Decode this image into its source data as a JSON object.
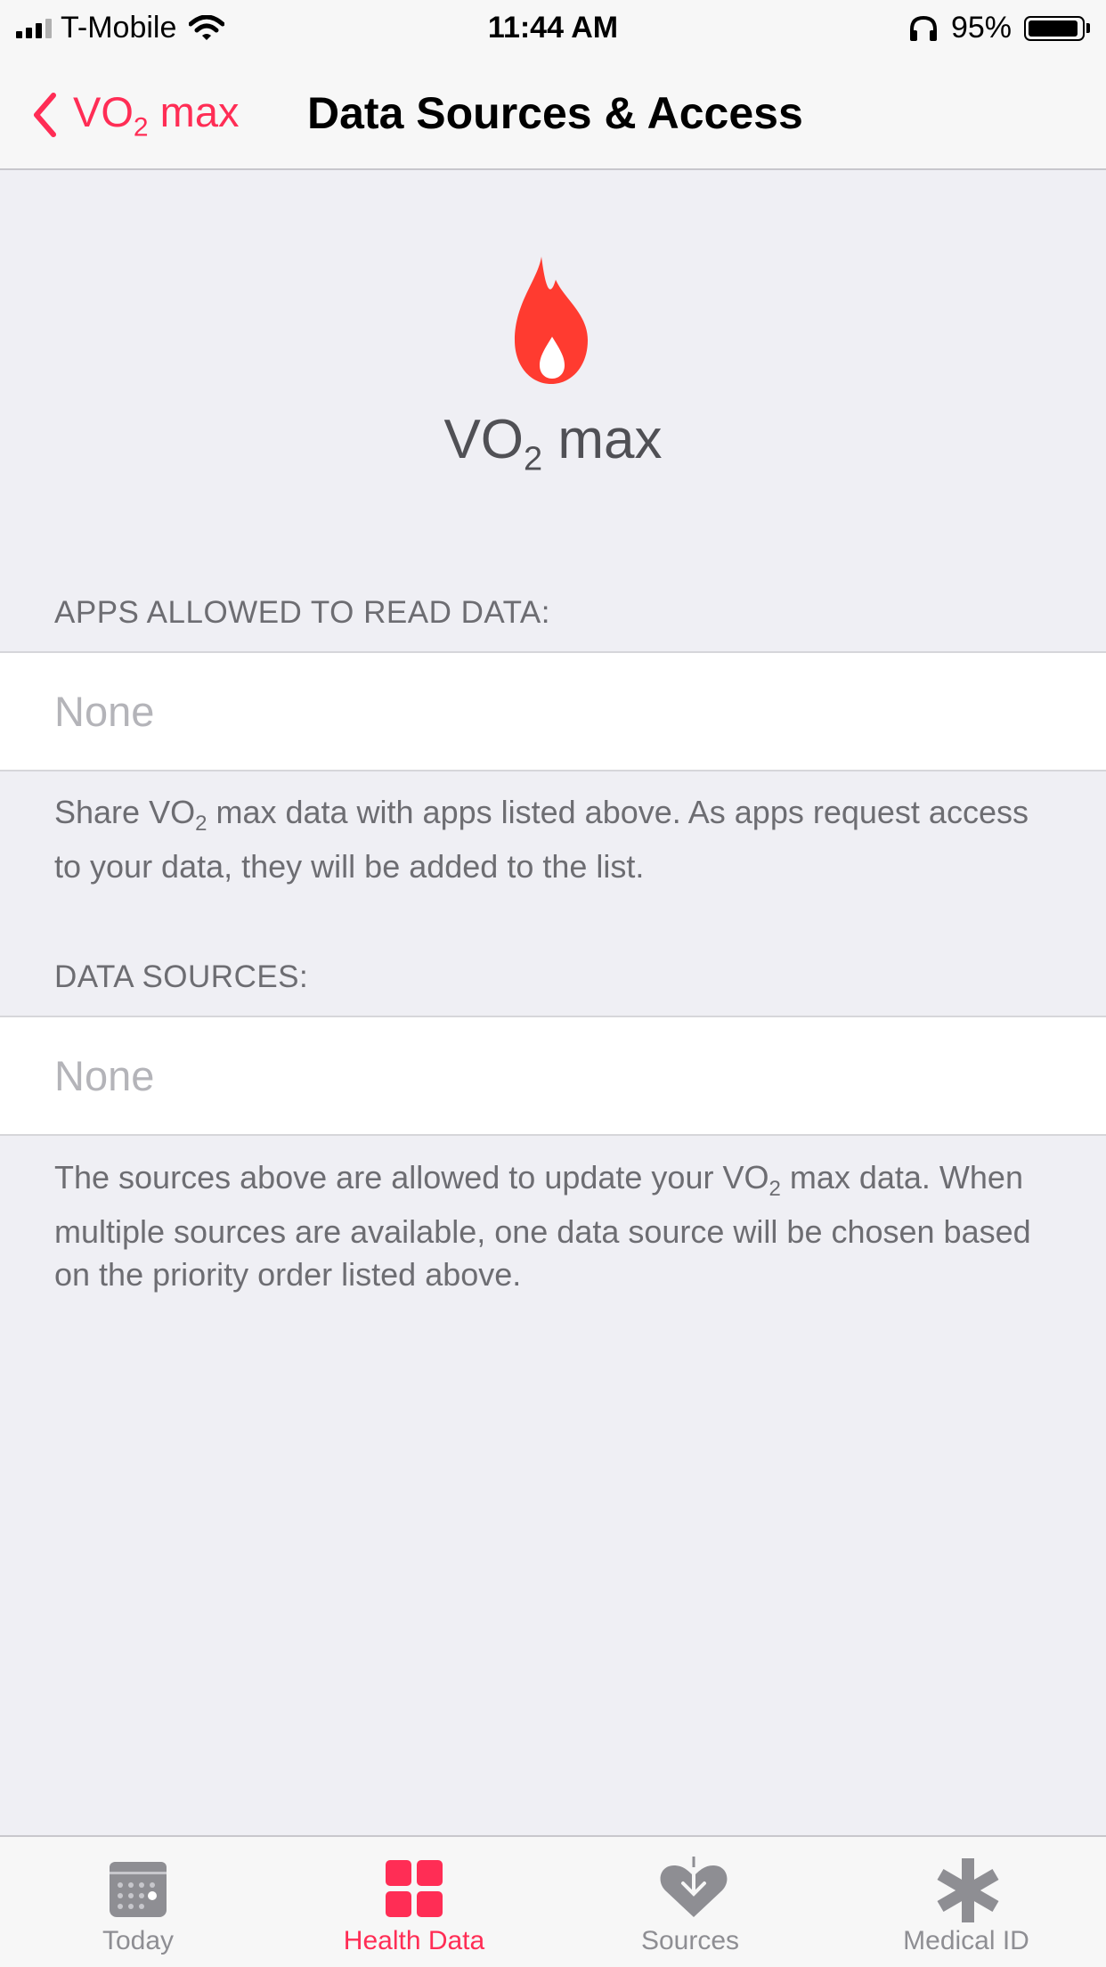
{
  "status_bar": {
    "carrier": "T-Mobile",
    "time": "11:44 AM",
    "battery_percent": "95%",
    "battery_level": 0.95
  },
  "nav": {
    "back_label_main": "VO",
    "back_label_sub": "2",
    "back_label_rest": " max",
    "title": "Data Sources & Access"
  },
  "hero": {
    "icon": "flame-icon",
    "title_main": "VO",
    "title_sub": "2",
    "title_rest": " max"
  },
  "sections": {
    "read_access": {
      "header": "APPS ALLOWED TO READ DATA:",
      "value": "None",
      "footer_pre": "Share VO",
      "footer_sub": "2",
      "footer_post": " max data with apps listed above. As apps request access to your data, they will be added to the list."
    },
    "data_sources": {
      "header": "DATA SOURCES:",
      "value": "None",
      "footer_pre": "The sources above are allowed to update your VO",
      "footer_sub": "2",
      "footer_post": " max data. When multiple sources are available, one data source will be chosen based on the priority order listed above."
    }
  },
  "tab_bar": {
    "tabs": [
      {
        "label": "Today",
        "icon": "calendar-icon",
        "active": false
      },
      {
        "label": "Health Data",
        "icon": "grid-icon",
        "active": true
      },
      {
        "label": "Sources",
        "icon": "heart-download-icon",
        "active": false
      },
      {
        "label": "Medical ID",
        "icon": "asterisk-icon",
        "active": false
      }
    ]
  },
  "colors": {
    "accent": "#ff2d55",
    "flame": "#ff3b30",
    "background": "#efeff4"
  }
}
